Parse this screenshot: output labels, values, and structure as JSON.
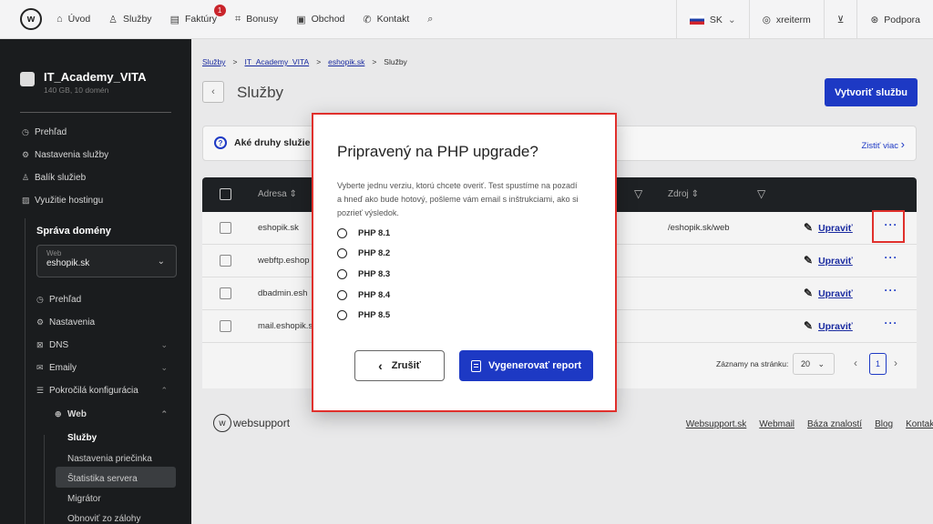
{
  "topnav": {
    "items": [
      {
        "icon": "home-icon",
        "glyph": "⌂",
        "label": "Úvod"
      },
      {
        "icon": "services-icon",
        "glyph": "♙",
        "label": "Služby"
      },
      {
        "icon": "invoices-icon",
        "glyph": "▤",
        "label": "Faktúry",
        "badge": "1"
      },
      {
        "icon": "gift-icon",
        "glyph": "⌗",
        "label": "Bonusy"
      },
      {
        "icon": "shop-icon",
        "glyph": "▣",
        "label": "Obchod"
      },
      {
        "icon": "phone-icon",
        "glyph": "✆",
        "label": "Kontakt"
      }
    ],
    "lang": "SK",
    "user": "xreiterm",
    "support": "Podpora"
  },
  "sidebar": {
    "account_name": "IT_Academy_VITA",
    "account_sub": "140 GB, 10 domén",
    "items": [
      "Prehľad",
      "Nastavenia služby",
      "Balík služieb",
      "Využitie hostingu"
    ],
    "domain_title": "Správa domény",
    "domain_label": "Web",
    "domain_value": "eshopik.sk",
    "domain_items": [
      "Prehľad",
      "Nastavenia",
      "DNS",
      "Emaily",
      "Pokročilá konfigurácia"
    ],
    "web_label": "Web",
    "web_items": [
      "Služby",
      "Nastavenia priečinka",
      "Štatistika servera",
      "Migrátor",
      "Obnoviť zo zálohy"
    ]
  },
  "breadcrumb": [
    "Služby",
    "IT_Academy_VITA",
    "eshopik.sk",
    "Služby"
  ],
  "page_title": "Služby",
  "create_button": "Vytvoriť službu",
  "info_text": "Aké druhy služie",
  "info_more": "Zistiť viac",
  "table": {
    "col_address": "Adresa",
    "col_source": "Zdroj",
    "rows": [
      {
        "address": "eshopik.sk",
        "source": "/eshopik.sk/web",
        "edit": "Upraviť"
      },
      {
        "address": "webftp.eshop",
        "source": "",
        "edit": "Upraviť"
      },
      {
        "address": "dbadmin.esh",
        "source": "",
        "edit": "Upraviť"
      },
      {
        "address": "mail.eshopik.s",
        "source": "",
        "edit": "Upraviť"
      }
    ],
    "per_page_label": "Záznamy na stránku:",
    "per_page": "20",
    "page": "1"
  },
  "footer": {
    "logo": "websupport",
    "links": [
      "Websupport.sk",
      "Webmail",
      "Báza znalostí",
      "Blog",
      "Kontakt"
    ]
  },
  "modal": {
    "title": "Pripravený na PHP upgrade?",
    "description": "Vyberte jednu verziu, ktorú chcete overiť. Test spustíme na pozadí a hneď ako bude hotový, pošleme vám email s inštrukciami, ako si pozrieť výsledok.",
    "options": [
      "PHP 8.1",
      "PHP 8.2",
      "PHP 8.3",
      "PHP 8.4",
      "PHP 8.5"
    ],
    "cancel": "Zrušiť",
    "generate": "Vygenerovať report"
  }
}
